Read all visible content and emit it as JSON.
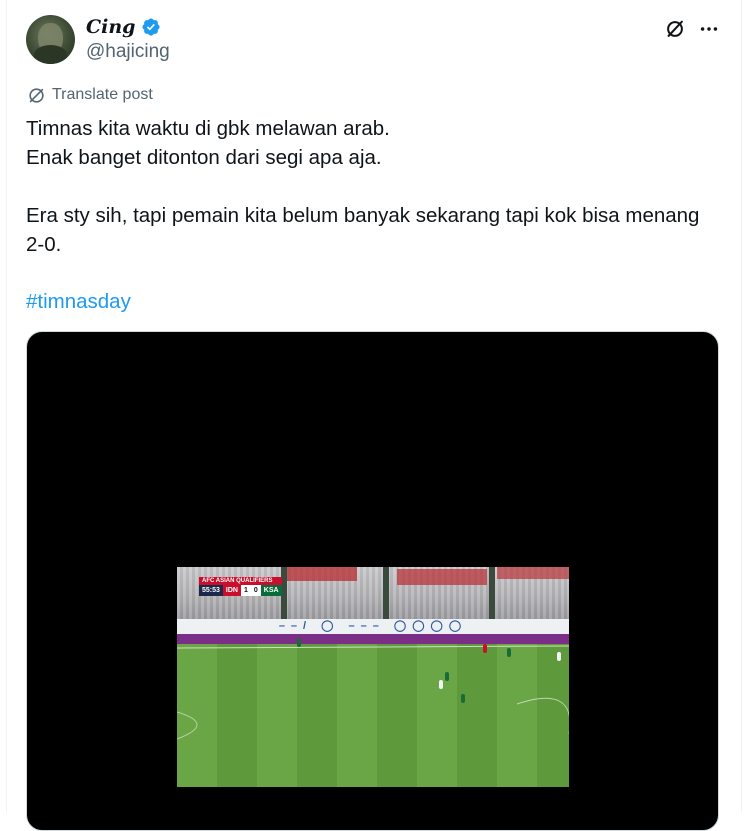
{
  "tweet": {
    "display_name": "Cing",
    "handle": "@hajicing",
    "translate_label": "Translate post",
    "body_lines": [
      "Timnas kita waktu di gbk melawan arab.",
      "Enak banget ditonton dari segi apa aja.",
      "",
      "Era sty sih, tapi pemain kita belum banyak sekarang tapi kok bisa menang 2-0."
    ],
    "hashtag": "#timnasday"
  },
  "icons": {
    "verified": "verified-badge-icon",
    "grok": "grok-icon",
    "more": "more-horizontal-icon",
    "translate": "globe-translate-icon"
  },
  "video": {
    "scorebug": {
      "competition": "AFC ASIAN QUALIFIERS",
      "clock": "55:53",
      "home": "IDN",
      "home_score": "1",
      "away_score": "0",
      "away": "KSA"
    }
  },
  "colors": {
    "link": "#1d9bf0",
    "secondary_text": "#536471",
    "verified": "#1d9bf0"
  }
}
